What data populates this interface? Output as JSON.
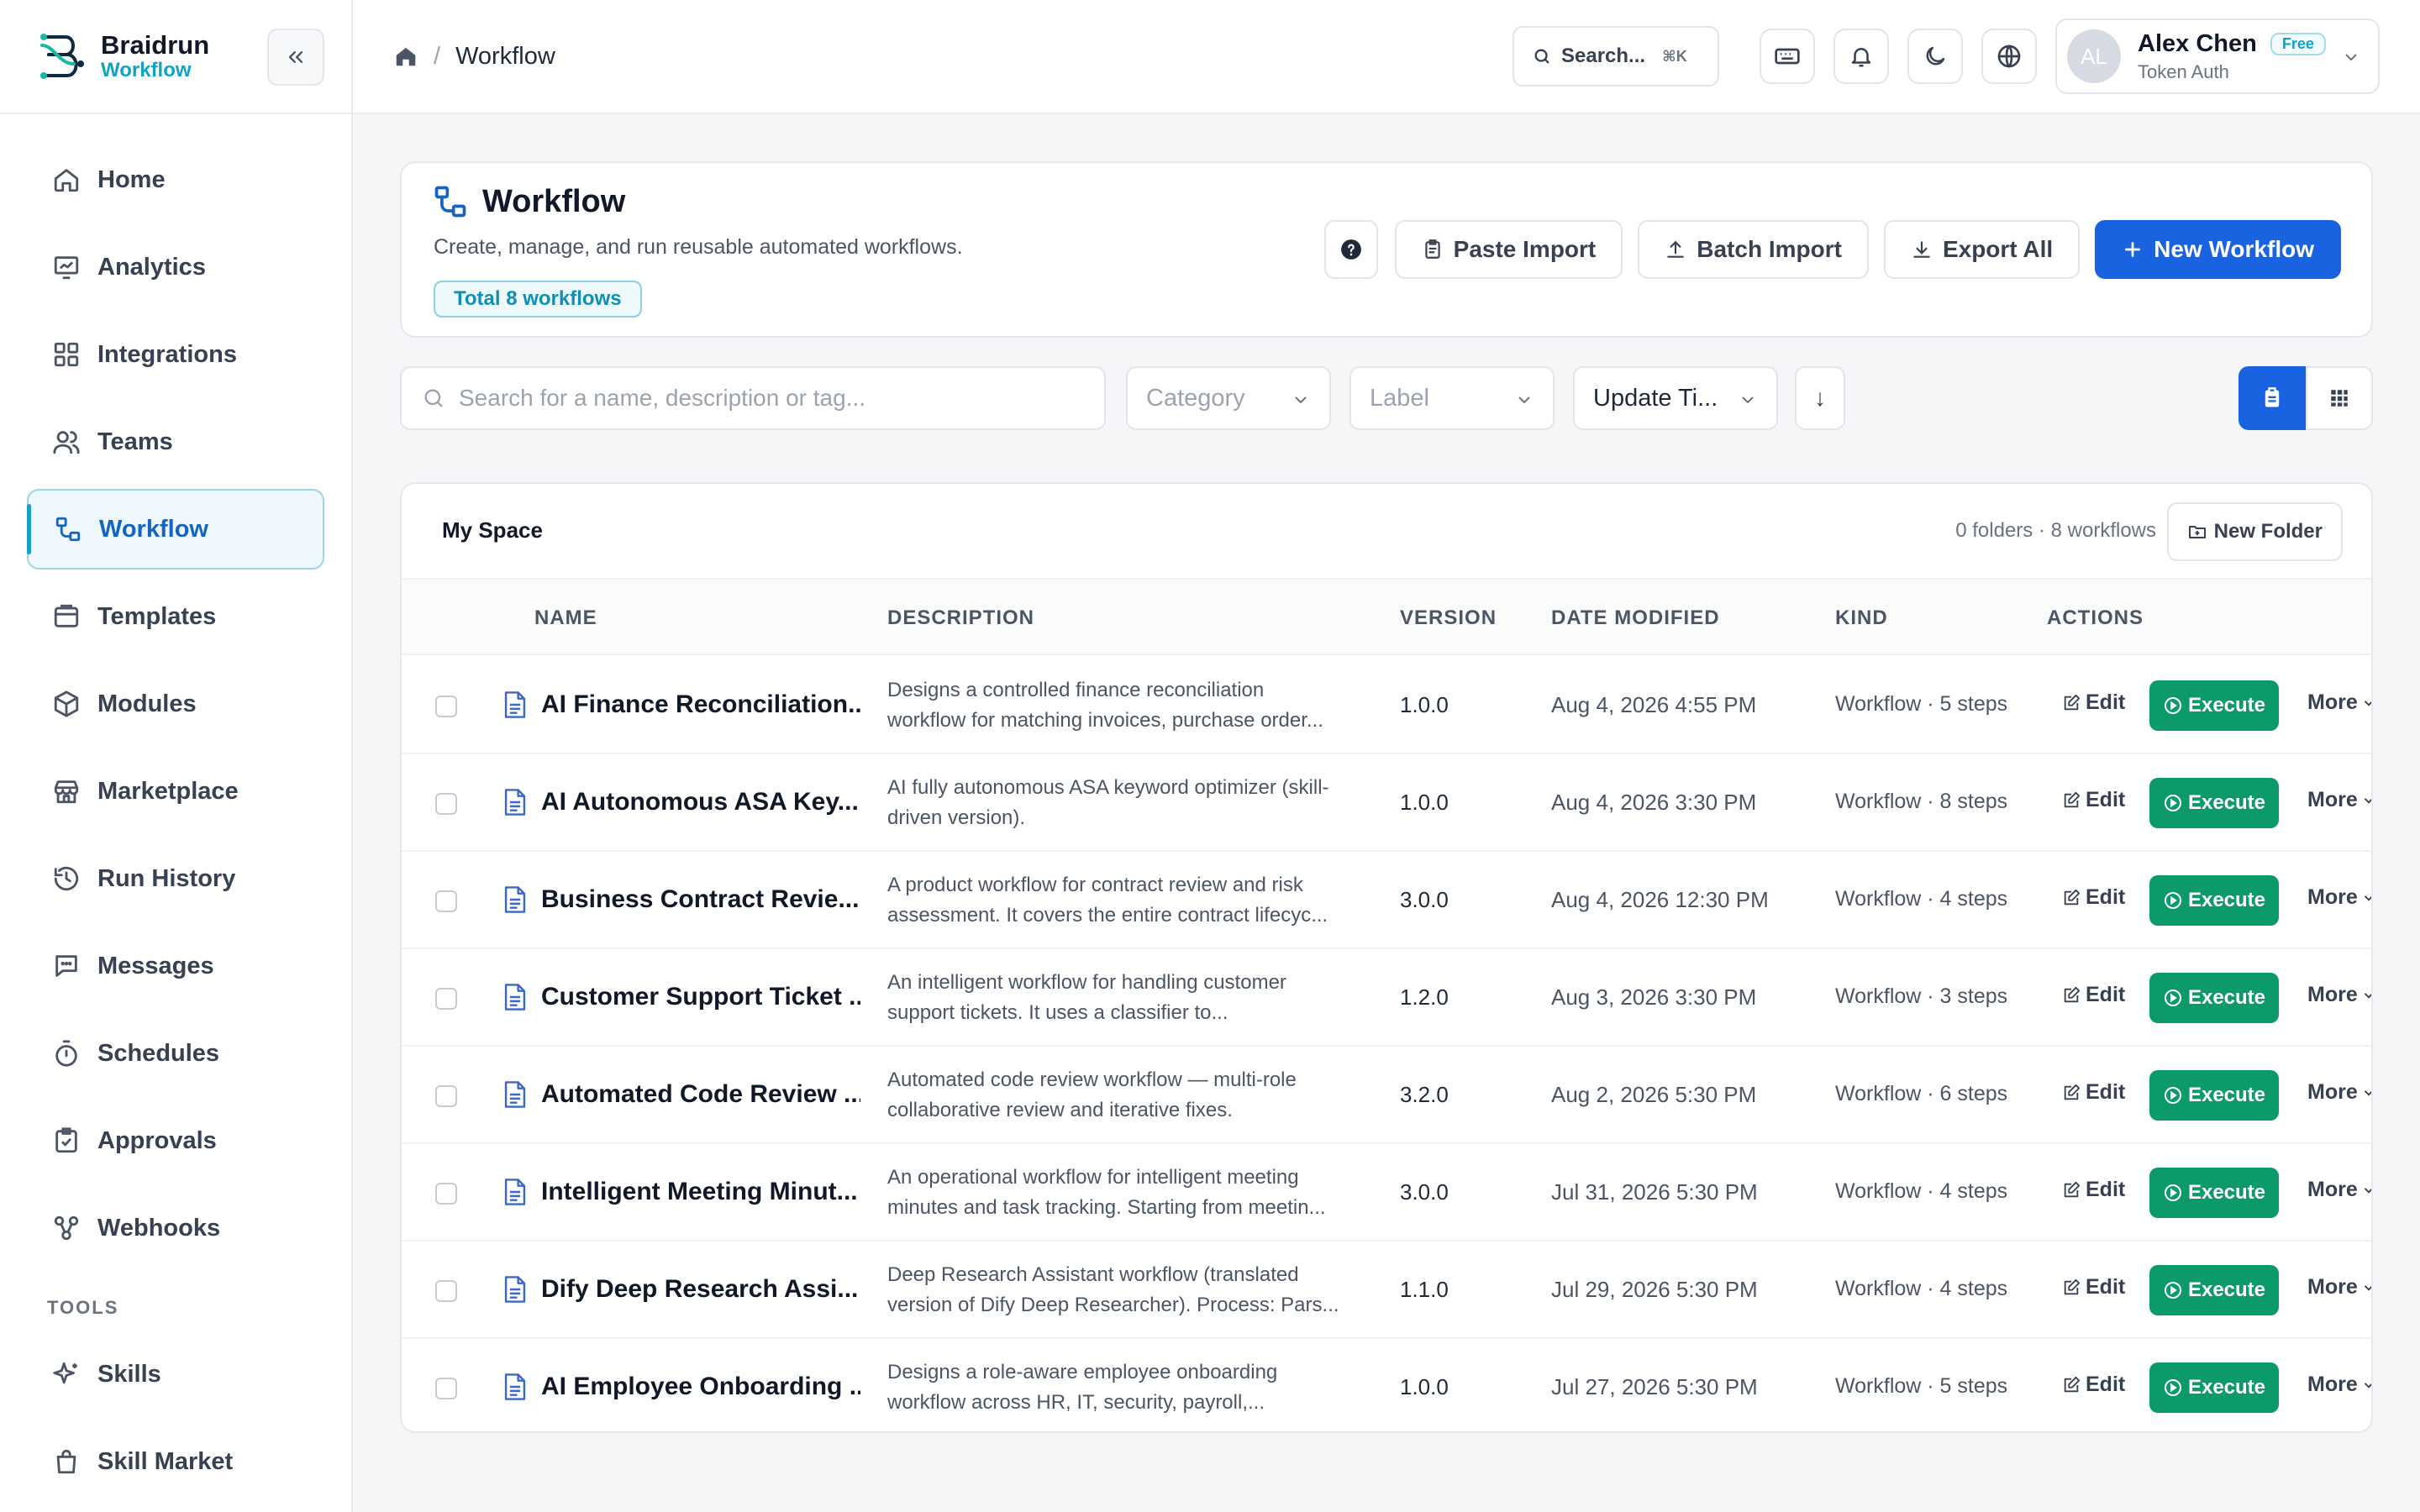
{
  "brand": {
    "name": "Braidrun",
    "sub": "Workflow"
  },
  "sidebar": {
    "items": [
      {
        "label": "Home",
        "icon": "home-icon"
      },
      {
        "label": "Analytics",
        "icon": "analytics-icon"
      },
      {
        "label": "Integrations",
        "icon": "integrations-icon"
      },
      {
        "label": "Teams",
        "icon": "teams-icon"
      },
      {
        "label": "Workflow",
        "icon": "workflow-icon",
        "active": true
      },
      {
        "label": "Templates",
        "icon": "templates-icon"
      },
      {
        "label": "Modules",
        "icon": "modules-icon"
      },
      {
        "label": "Marketplace",
        "icon": "marketplace-icon"
      },
      {
        "label": "Run History",
        "icon": "history-icon"
      },
      {
        "label": "Messages",
        "icon": "messages-icon"
      },
      {
        "label": "Schedules",
        "icon": "timer-icon"
      },
      {
        "label": "Approvals",
        "icon": "approvals-icon"
      },
      {
        "label": "Webhooks",
        "icon": "webhooks-icon"
      }
    ],
    "tools_label": "TOOLS",
    "tools": [
      {
        "label": "Skills",
        "icon": "sparkle-icon"
      },
      {
        "label": "Skill Market",
        "icon": "bag-icon"
      }
    ]
  },
  "header": {
    "breadcrumb_current": "Workflow",
    "search_label": "Search...",
    "search_shortcut": "⌘K",
    "user": {
      "initials": "AL",
      "name": "Alex Chen",
      "plan": "Free",
      "auth": "Token Auth"
    }
  },
  "hero": {
    "title": "Workflow",
    "description": "Create, manage, and run reusable automated workflows.",
    "total_badge": "Total 8 workflows",
    "buttons": {
      "paste": "Paste Import",
      "batch": "Batch Import",
      "export": "Export All",
      "new": "New Workflow"
    }
  },
  "filters": {
    "search_placeholder": "Search for a name, description or tag...",
    "category": "Category",
    "label": "Label",
    "sort": "Update Ti...",
    "sort_dir": "↓"
  },
  "space": {
    "title": "My Space",
    "meta": "0 folders · 8 workflows",
    "new_folder": "New Folder"
  },
  "table": {
    "columns": [
      "NAME",
      "DESCRIPTION",
      "VERSION",
      "DATE MODIFIED",
      "KIND",
      "ACTIONS"
    ],
    "action_labels": {
      "edit": "Edit",
      "execute": "Execute",
      "more": "More"
    },
    "rows": [
      {
        "name": "AI Finance Reconciliation...",
        "desc1": "Designs a controlled finance reconciliation",
        "desc2": "workflow for matching invoices, purchase order...",
        "version": "1.0.0",
        "date": "Aug 4, 2026 4:55 PM",
        "kind": "Workflow · 5 steps"
      },
      {
        "name": "AI Autonomous ASA Key...",
        "desc1": "AI fully autonomous ASA keyword optimizer (skill-",
        "desc2": "driven version).",
        "version": "1.0.0",
        "date": "Aug 4, 2026 3:30 PM",
        "kind": "Workflow · 8 steps"
      },
      {
        "name": "Business Contract Revie...",
        "desc1": "A product workflow for contract review and risk",
        "desc2": "assessment. It covers the entire contract lifecyc...",
        "version": "3.0.0",
        "date": "Aug 4, 2026 12:30 PM",
        "kind": "Workflow · 4 steps"
      },
      {
        "name": "Customer Support Ticket ...",
        "desc1": "An intelligent workflow for handling customer",
        "desc2": "support tickets. It uses a classifier to...",
        "version": "1.2.0",
        "date": "Aug 3, 2026 3:30 PM",
        "kind": "Workflow · 3 steps"
      },
      {
        "name": "Automated Code Review ...",
        "desc1": "Automated code review workflow — multi-role",
        "desc2": "collaborative review and iterative fixes.",
        "version": "3.2.0",
        "date": "Aug 2, 2026 5:30 PM",
        "kind": "Workflow · 6 steps"
      },
      {
        "name": "Intelligent Meeting Minut...",
        "desc1": "An operational workflow for intelligent meeting",
        "desc2": "minutes and task tracking. Starting from meetin...",
        "version": "3.0.0",
        "date": "Jul 31, 2026 5:30 PM",
        "kind": "Workflow · 4 steps"
      },
      {
        "name": "Dify Deep Research Assi...",
        "desc1": "Deep Research Assistant workflow (translated",
        "desc2": "version of Dify Deep Researcher). Process: Pars...",
        "version": "1.1.0",
        "date": "Jul 29, 2026 5:30 PM",
        "kind": "Workflow · 4 steps"
      },
      {
        "name": "AI Employee Onboarding ...",
        "desc1": "Designs a role-aware employee onboarding",
        "desc2": "workflow across HR, IT, security, payroll,...",
        "version": "1.0.0",
        "date": "Jul 27, 2026 5:30 PM",
        "kind": "Workflow · 5 steps"
      }
    ]
  },
  "colors": {
    "primary": "#1a63e0",
    "execute": "#0c9a68",
    "accent": "#10a3c4"
  }
}
